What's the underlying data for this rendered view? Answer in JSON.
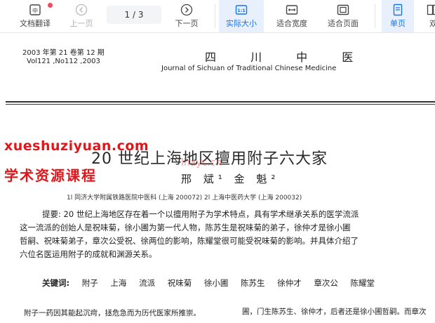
{
  "toolbar": {
    "translate_label": "文档翻译",
    "prev_label": "上一页",
    "page_current": "1",
    "page_sep": "/",
    "page_total": "3",
    "next_label": "下一页",
    "actual_size_label": "实际大小",
    "fit_width_label": "适合宽度",
    "fit_page_label": "适合页面",
    "single_page_label": "单页",
    "double_page_label": "双",
    "accent_color": "#1a73e8"
  },
  "document": {
    "header_left_line1": "2003 年第 21 卷第 12 期",
    "header_left_line2": "Vol121 ,No112 ,2003",
    "journal_cn": "四 川 中 医",
    "journal_en": "Journal of Sichuan of Traditional Chinese Medicine",
    "title": "20 世纪上海地区擅用附子六大家",
    "authors": "邢 斌¹ 金 魁²",
    "affiliations": "1l 同济大学附属铁路医院中医科 (上海 200072)    2l 上海中医药大学 (上海 200032)",
    "abstract_lines": [
      "提要: 20 世纪上海地区存在着一个以擅用附子为学术特点，具有学术继承关系的医学流派",
      "这一流派的创始人是祝味菊，徐小圃为第一代人物，陈苏生是祝味菊的弟子，徐仲才是徐小圃",
      "哲嗣、祝味菊弟子，章次公受祝、徐两位的影响，陈耀堂很可能受祝味菊的影响。并具体介绍了",
      "六位名医运用附子的成就和渊源关系。"
    ],
    "keywords_label": "关键词:",
    "keywords": [
      "附子",
      "上海",
      "流派",
      "祝味菊",
      "徐小圃",
      "陈苏生",
      "徐仲才",
      "章次公",
      "陈耀堂"
    ],
    "body_left": "附子一药因其能起沉疴，拯危急而为历代医家所推崇。",
    "body_right": "圃，门生陈苏生、徐仲才，后者还是徐小圃哲嗣。而章次"
  },
  "watermark": {
    "line1": "xueshuziyuan.com",
    "line2": "学术资源课程",
    "line3": "lhayc.cn"
  }
}
